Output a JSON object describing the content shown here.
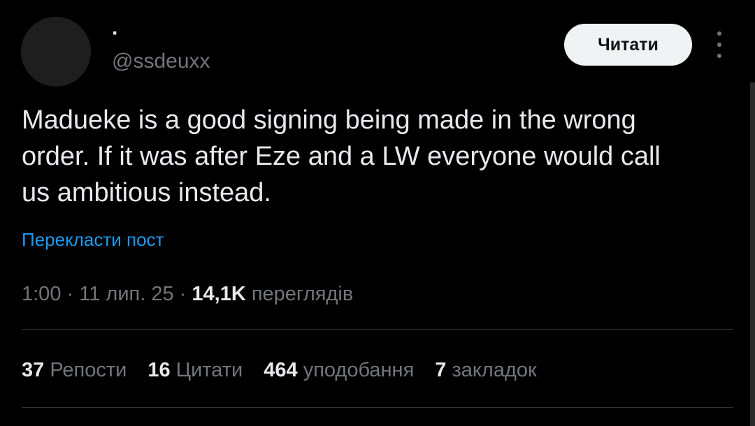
{
  "author": {
    "display_name": "·",
    "handle": "@ssdeuxx"
  },
  "follow_button": {
    "label": "Читати"
  },
  "more_icon": "more-vertical-icon",
  "tweet": {
    "text_line_1": "Madueke is a good signing being made in the wrong",
    "text_line_2": "order. If it was after Eze and a LW everyone would call",
    "text_line_3": "us ambitious instead."
  },
  "translate_link": "Перекласти пост",
  "meta": {
    "time": "1:00",
    "sep1": " · ",
    "date": "11 лип. 25",
    "sep2": " · ",
    "views_count": "14,1K",
    "views_label": " переглядів"
  },
  "stats": {
    "reposts": {
      "count": "37",
      "label": "Репости"
    },
    "quotes": {
      "count": "16",
      "label": "Цитати"
    },
    "likes": {
      "count": "464",
      "label": "уподобання"
    },
    "bookmarks": {
      "count": "7",
      "label": "закладок"
    }
  },
  "colors": {
    "background": "#000000",
    "text_primary": "#e7e9ea",
    "text_secondary": "#71767b",
    "link": "#1d9bf0",
    "button_bg": "#eff3f4",
    "divider": "#2f3336"
  }
}
